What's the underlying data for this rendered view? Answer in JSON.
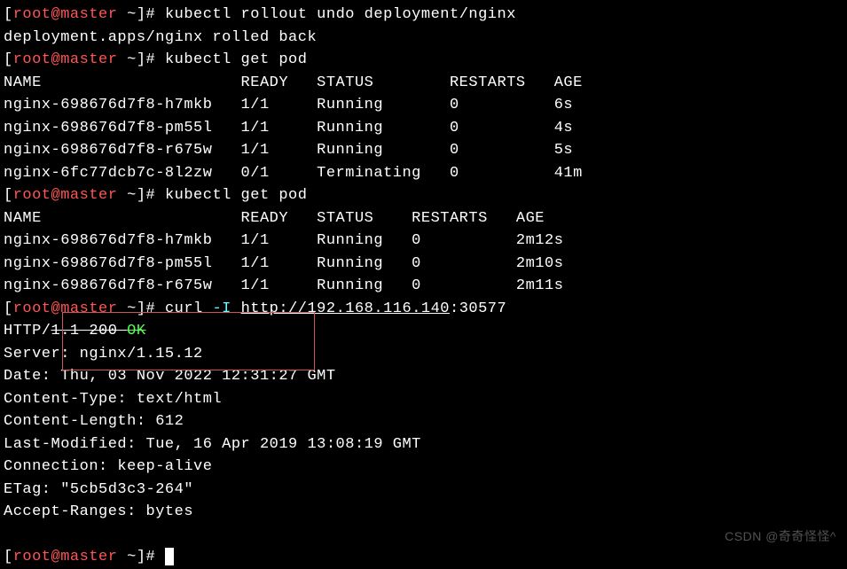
{
  "prompt": {
    "l_bracket": "[",
    "user_host": "root@master",
    "sep": " ",
    "tilde": "~",
    "r_bracket": "]# "
  },
  "cmd1": "kubectl rollout undo deployment/nginx",
  "out1": "deployment.apps/nginx rolled back",
  "cmd2": "kubectl get pod",
  "hdr1": "NAME                     READY   STATUS        RESTARTS   AGE",
  "rows1": {
    "r0": "nginx-698676d7f8-h7mkb   1/1     Running       0          6s",
    "r1": "nginx-698676d7f8-pm55l   1/1     Running       0          4s",
    "r2": "nginx-698676d7f8-r675w   1/1     Running       0          5s",
    "r3": "nginx-6fc77dcb7c-8l2zw   0/1     Terminating   0          41m"
  },
  "cmd3": "kubectl get pod",
  "hdr2": "NAME                     READY   STATUS    RESTARTS   AGE",
  "rows2": {
    "r0": "nginx-698676d7f8-h7mkb   1/1     Running   0          2m12s",
    "r1": "nginx-698676d7f8-pm55l   1/1     Running   0          2m10s",
    "r2": "nginx-698676d7f8-r675w   1/1     Running   0          2m11s"
  },
  "cmd4a": "curl ",
  "cmd4b": "-I",
  "cmd4c": " ",
  "cmd4url": "http://192.168.116.140",
  "cmd4port": ":30577",
  "http": {
    "a": "HTTP/",
    "b": "1.1 200 ",
    "ok": "OK"
  },
  "resp": {
    "l0": "Server: nginx/1.15.12",
    "l1": "Date: Thu, 03 Nov 2022 12:31:27 GMT",
    "l2": "Content-Type: text/html",
    "l3": "Content-Length: 612",
    "l4": "Last-Modified: Tue, 16 Apr 2019 13:08:19 GMT",
    "l5": "Connection: keep-alive",
    "l6": "ETag: \"5cb5d3c3-264\"",
    "l7": "Accept-Ranges: bytes"
  },
  "watermark": "CSDN @奇奇怪怪^"
}
